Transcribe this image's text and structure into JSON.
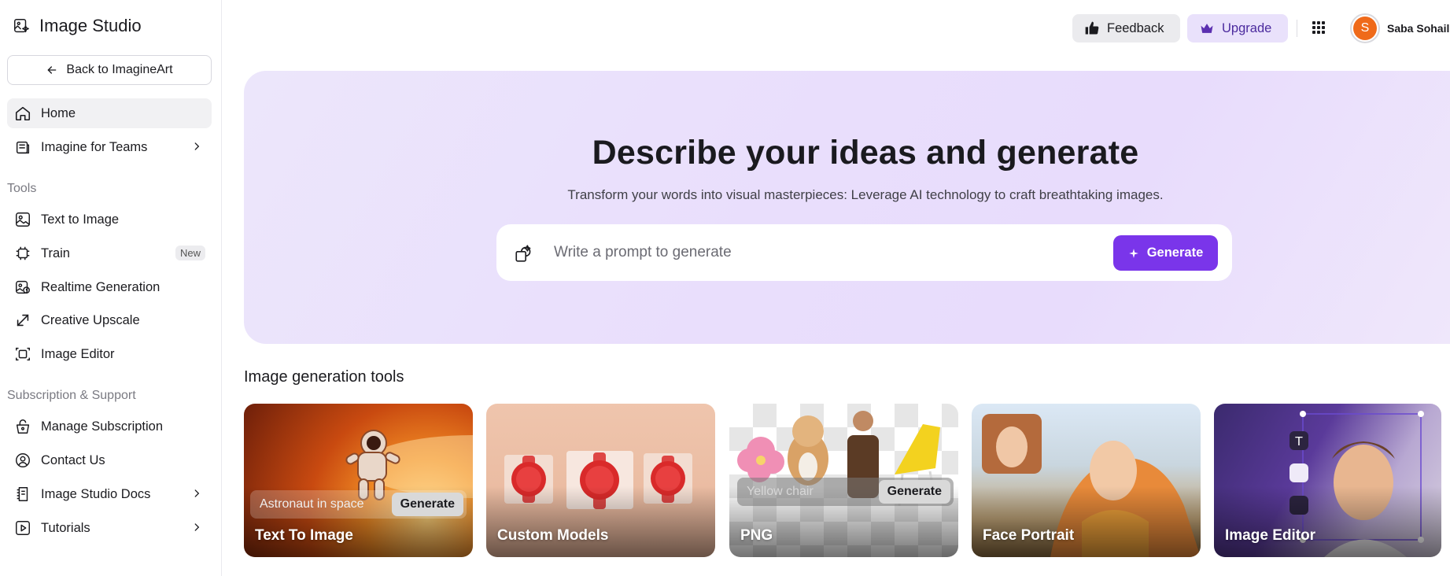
{
  "app": {
    "title": "Image Studio"
  },
  "sidebar": {
    "back_label": "Back to ImagineArt",
    "main_items": [
      {
        "label": "Home",
        "icon": "home-icon",
        "active": true
      },
      {
        "label": "Imagine for Teams",
        "icon": "teams-icon",
        "has_chevron": true
      }
    ],
    "tools_title": "Tools",
    "tools": [
      {
        "label": "Text to Image",
        "icon": "image-icon"
      },
      {
        "label": "Train",
        "icon": "chip-icon",
        "badge": "New"
      },
      {
        "label": "Realtime Generation",
        "icon": "realtime-icon"
      },
      {
        "label": "Creative Upscale",
        "icon": "upscale-icon"
      },
      {
        "label": "Image Editor",
        "icon": "editor-icon"
      }
    ],
    "support_title": "Subscription & Support",
    "support": [
      {
        "label": "Manage Subscription",
        "icon": "subscription-icon"
      },
      {
        "label": "Contact Us",
        "icon": "contact-icon"
      },
      {
        "label": "Image Studio Docs",
        "icon": "docs-icon",
        "has_chevron": true
      },
      {
        "label": "Tutorials",
        "icon": "tutorials-icon",
        "has_chevron": true
      }
    ]
  },
  "header": {
    "feedback_label": "Feedback",
    "upgrade_label": "Upgrade",
    "avatar_initial": "S",
    "user_name": "Saba Sohail"
  },
  "hero": {
    "title": "Describe your ideas and generate",
    "subtitle": "Transform your words into visual masterpieces: Leverage AI technology to craft breathtaking images.",
    "prompt_placeholder": "Write a prompt to generate",
    "generate_label": "Generate"
  },
  "tools_section": {
    "title": "Image generation tools",
    "cards": [
      {
        "label": "Text To Image",
        "input_text": "Astronaut in space",
        "button": "Generate"
      },
      {
        "label": "Custom Models"
      },
      {
        "label": "PNG",
        "input_text": "Yellow chair",
        "button": "Generate"
      },
      {
        "label": "Face Portrait"
      },
      {
        "label": "Image Editor"
      }
    ]
  },
  "colors": {
    "accent": "#7a35ea",
    "upgrade_bg": "#e9e1fb",
    "avatar": "#ef6a1a"
  }
}
